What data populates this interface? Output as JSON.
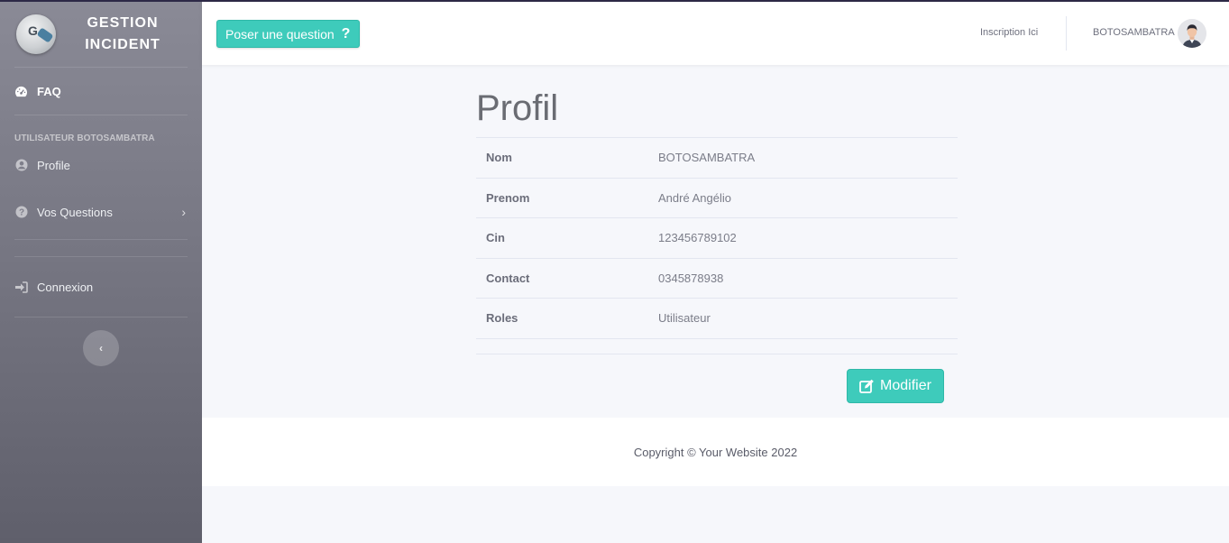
{
  "brand": {
    "name": "GESTION\nINCIDENT"
  },
  "sidebar": {
    "faq_label": "FAQ",
    "section_heading": "UTILISATEUR BOTOSAMBATRA",
    "items": [
      {
        "label": "Profile",
        "icon": "user-circle-icon"
      },
      {
        "label": "Vos Questions",
        "icon": "question-circle-icon"
      },
      {
        "label": "Connexion",
        "icon": "sign-in-icon"
      }
    ],
    "toggle_icon": "chevron-left-icon"
  },
  "topbar": {
    "ask_button": "Poser une question",
    "signup_link": "Inscription Ici",
    "user_name": "BOTOSAMBATRA"
  },
  "profile": {
    "title": "Profil",
    "rows": [
      {
        "key": "Nom",
        "value": "BOTOSAMBATRA"
      },
      {
        "key": "Prenom",
        "value": "André Angélio"
      },
      {
        "key": "Cin",
        "value": "123456789102"
      },
      {
        "key": "Contact",
        "value": "0345878938"
      },
      {
        "key": "Roles",
        "value": "Utilisateur"
      }
    ],
    "edit_button": "Modifier"
  },
  "footer": {
    "copyright": "Copyright © Your Website 2022"
  },
  "colors": {
    "accent": "#3ecbbb",
    "sidebar": "#7b7b87",
    "background": "#f6f7fb"
  }
}
